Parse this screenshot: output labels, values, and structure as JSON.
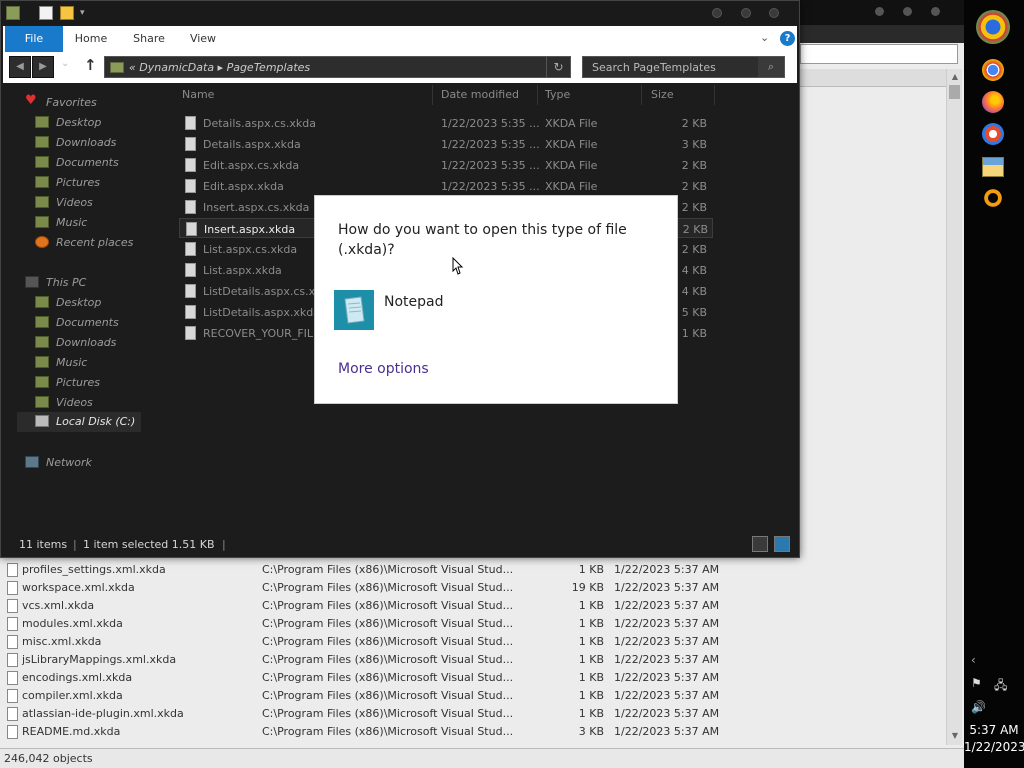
{
  "background_window": {
    "rows": [
      {
        "name": "profiles_settings.xml.xkda",
        "path": "C:\\Program Files (x86)\\Microsoft Visual Stud...",
        "size": "1 KB",
        "date": "1/22/2023 5:37 AM"
      },
      {
        "name": "workspace.xml.xkda",
        "path": "C:\\Program Files (x86)\\Microsoft Visual Stud...",
        "size": "19 KB",
        "date": "1/22/2023 5:37 AM"
      },
      {
        "name": "vcs.xml.xkda",
        "path": "C:\\Program Files (x86)\\Microsoft Visual Stud...",
        "size": "1 KB",
        "date": "1/22/2023 5:37 AM"
      },
      {
        "name": "modules.xml.xkda",
        "path": "C:\\Program Files (x86)\\Microsoft Visual Stud...",
        "size": "1 KB",
        "date": "1/22/2023 5:37 AM"
      },
      {
        "name": "misc.xml.xkda",
        "path": "C:\\Program Files (x86)\\Microsoft Visual Stud...",
        "size": "1 KB",
        "date": "1/22/2023 5:37 AM"
      },
      {
        "name": "jsLibraryMappings.xml.xkda",
        "path": "C:\\Program Files (x86)\\Microsoft Visual Stud...",
        "size": "1 KB",
        "date": "1/22/2023 5:37 AM"
      },
      {
        "name": "encodings.xml.xkda",
        "path": "C:\\Program Files (x86)\\Microsoft Visual Stud...",
        "size": "1 KB",
        "date": "1/22/2023 5:37 AM"
      },
      {
        "name": "compiler.xml.xkda",
        "path": "C:\\Program Files (x86)\\Microsoft Visual Stud...",
        "size": "1 KB",
        "date": "1/22/2023 5:37 AM"
      },
      {
        "name": "atlassian-ide-plugin.xml.xkda",
        "path": "C:\\Program Files (x86)\\Microsoft Visual Stud...",
        "size": "1 KB",
        "date": "1/22/2023 5:37 AM"
      },
      {
        "name": "README.md.xkda",
        "path": "C:\\Program Files (x86)\\Microsoft Visual Stud...",
        "size": "3 KB",
        "date": "1/22/2023 5:37 AM"
      }
    ],
    "status": "246,042 objects"
  },
  "explorer": {
    "ribbon_tabs": {
      "file": "File",
      "home": "Home",
      "share": "Share",
      "view": "View"
    },
    "address": {
      "crumbs": "«  DynamicData  ▸  PageTemplates"
    },
    "search": {
      "placeholder": "Search PageTemplates"
    },
    "nav": {
      "favorites": "Favorites",
      "desktop": "Desktop",
      "downloads": "Downloads",
      "documents": "Documents",
      "pictures": "Pictures",
      "videos": "Videos",
      "music": "Music",
      "recent": "Recent places",
      "thispc": "This PC",
      "pc_desktop": "Desktop",
      "pc_documents": "Documents",
      "pc_downloads": "Downloads",
      "pc_music": "Music",
      "pc_pictures": "Pictures",
      "pc_videos": "Videos",
      "localdisk": "Local Disk (C:)",
      "network": "Network"
    },
    "columns": {
      "name": "Name",
      "date": "Date modified",
      "type": "Type",
      "size": "Size"
    },
    "files": [
      {
        "name": "Details.aspx.cs.xkda",
        "date": "1/22/2023 5:35 ...",
        "type": "XKDA File",
        "size": "2 KB"
      },
      {
        "name": "Details.aspx.xkda",
        "date": "1/22/2023 5:35 ...",
        "type": "XKDA File",
        "size": "3 KB"
      },
      {
        "name": "Edit.aspx.cs.xkda",
        "date": "1/22/2023 5:35 ...",
        "type": "XKDA File",
        "size": "2 KB"
      },
      {
        "name": "Edit.aspx.xkda",
        "date": "1/22/2023 5:35 ...",
        "type": "XKDA File",
        "size": "2 KB"
      },
      {
        "name": "Insert.aspx.cs.xkda",
        "date": "",
        "type": "",
        "size": "2 KB"
      },
      {
        "name": "Insert.aspx.xkda",
        "date": "",
        "type": "",
        "size": "2 KB"
      },
      {
        "name": "List.aspx.cs.xkda",
        "date": "",
        "type": "",
        "size": "2 KB"
      },
      {
        "name": "List.aspx.xkda",
        "date": "",
        "type": "",
        "size": "4 KB"
      },
      {
        "name": "ListDetails.aspx.cs.x",
        "date": "",
        "type": "",
        "size": "4 KB"
      },
      {
        "name": "ListDetails.aspx.xkda",
        "date": "",
        "type": "",
        "size": "5 KB"
      },
      {
        "name": "RECOVER_YOUR_FILE",
        "date": "",
        "type": "",
        "size": "1 KB"
      }
    ],
    "status": {
      "count": "11 items",
      "selected": "1 item selected  1.51 KB",
      "sep": "|"
    }
  },
  "dialog": {
    "question": "How do you want to open this type of file (.xkda)?",
    "app_name": "Notepad",
    "more_options": "More options"
  },
  "taskbar": {
    "time": "5:37 AM",
    "date": "1/22/2023"
  },
  "colors": {
    "file_tab": "#1979ca",
    "dialog_link": "#4b2f8f",
    "notepad_tile": "#1e8fa8"
  }
}
